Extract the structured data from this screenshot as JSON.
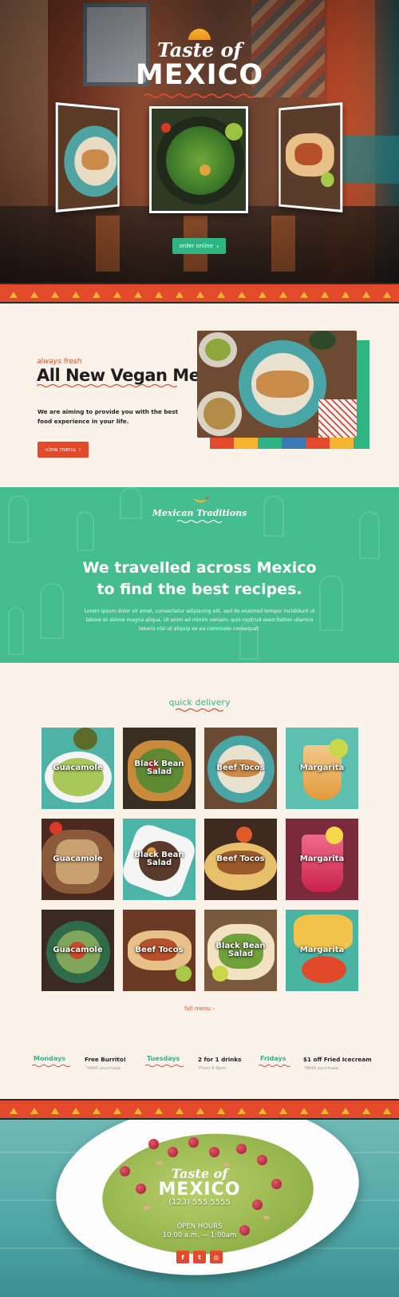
{
  "brand": {
    "name_small": "Taste of",
    "name_big": "MEXICO",
    "colors": {
      "red": "#e24a2b",
      "green": "#2fb584",
      "teal": "#46bd8e",
      "yellow": "#f6b431",
      "cream": "#fbf3ea"
    }
  },
  "hero": {
    "cta_label": "order online",
    "cta_icon": "chevron-right-icon"
  },
  "vegan": {
    "tag": "always fresh",
    "title": "All New Vegan Menu",
    "text": "We are aiming to provide you with the best food experience in your life.",
    "cta_label": "view menu"
  },
  "traditions": {
    "tag": "Mexican Traditions",
    "heading_line1": "We travelled across Mexico",
    "heading_line2": "to find the best recipes.",
    "body": "Lorem ipsum dolor sit amet, consectetur adipiscing elit, sed do eiusmod tempor incididunt ut labore et dolore magna aliqua. Ut enim ad minim veniam, quis nostrud exercitation ullamco laboris nisi ut aliquip ex ea commodo consequat."
  },
  "delivery": {
    "title": "quick delivery",
    "items": [
      "Guacamole",
      "Black Bean Salad",
      "Beef Tocos",
      "Margarita",
      "Guacamole",
      "Black Bean Salad",
      "Beef Tocos",
      "Margarita",
      "Guacamole",
      "Beef Tocos",
      "Black Bean Salad",
      "Margarita"
    ],
    "full_menu_label": "full menu"
  },
  "specials": [
    {
      "day": "Mondays",
      "deal": "Free Burrito!",
      "note": "*With purchase"
    },
    {
      "day": "Tuesdays",
      "deal": "2 for 1 drinks",
      "note": "From 6-8pm"
    },
    {
      "day": "Fridays",
      "deal": "$1 off Fried Icecream",
      "note": "*With purchase"
    }
  ],
  "footer": {
    "name_small": "Taste of",
    "name_big": "MEXICO",
    "phone": "(123) 555 5555",
    "hours_label": "OPEN HOURS",
    "hours": "10:00 a.m. — 1:00am",
    "social": [
      {
        "icon": "facebook-icon",
        "glyph": "f"
      },
      {
        "icon": "twitter-icon",
        "glyph": "t"
      },
      {
        "icon": "instagram-icon",
        "glyph": "◎"
      }
    ]
  }
}
